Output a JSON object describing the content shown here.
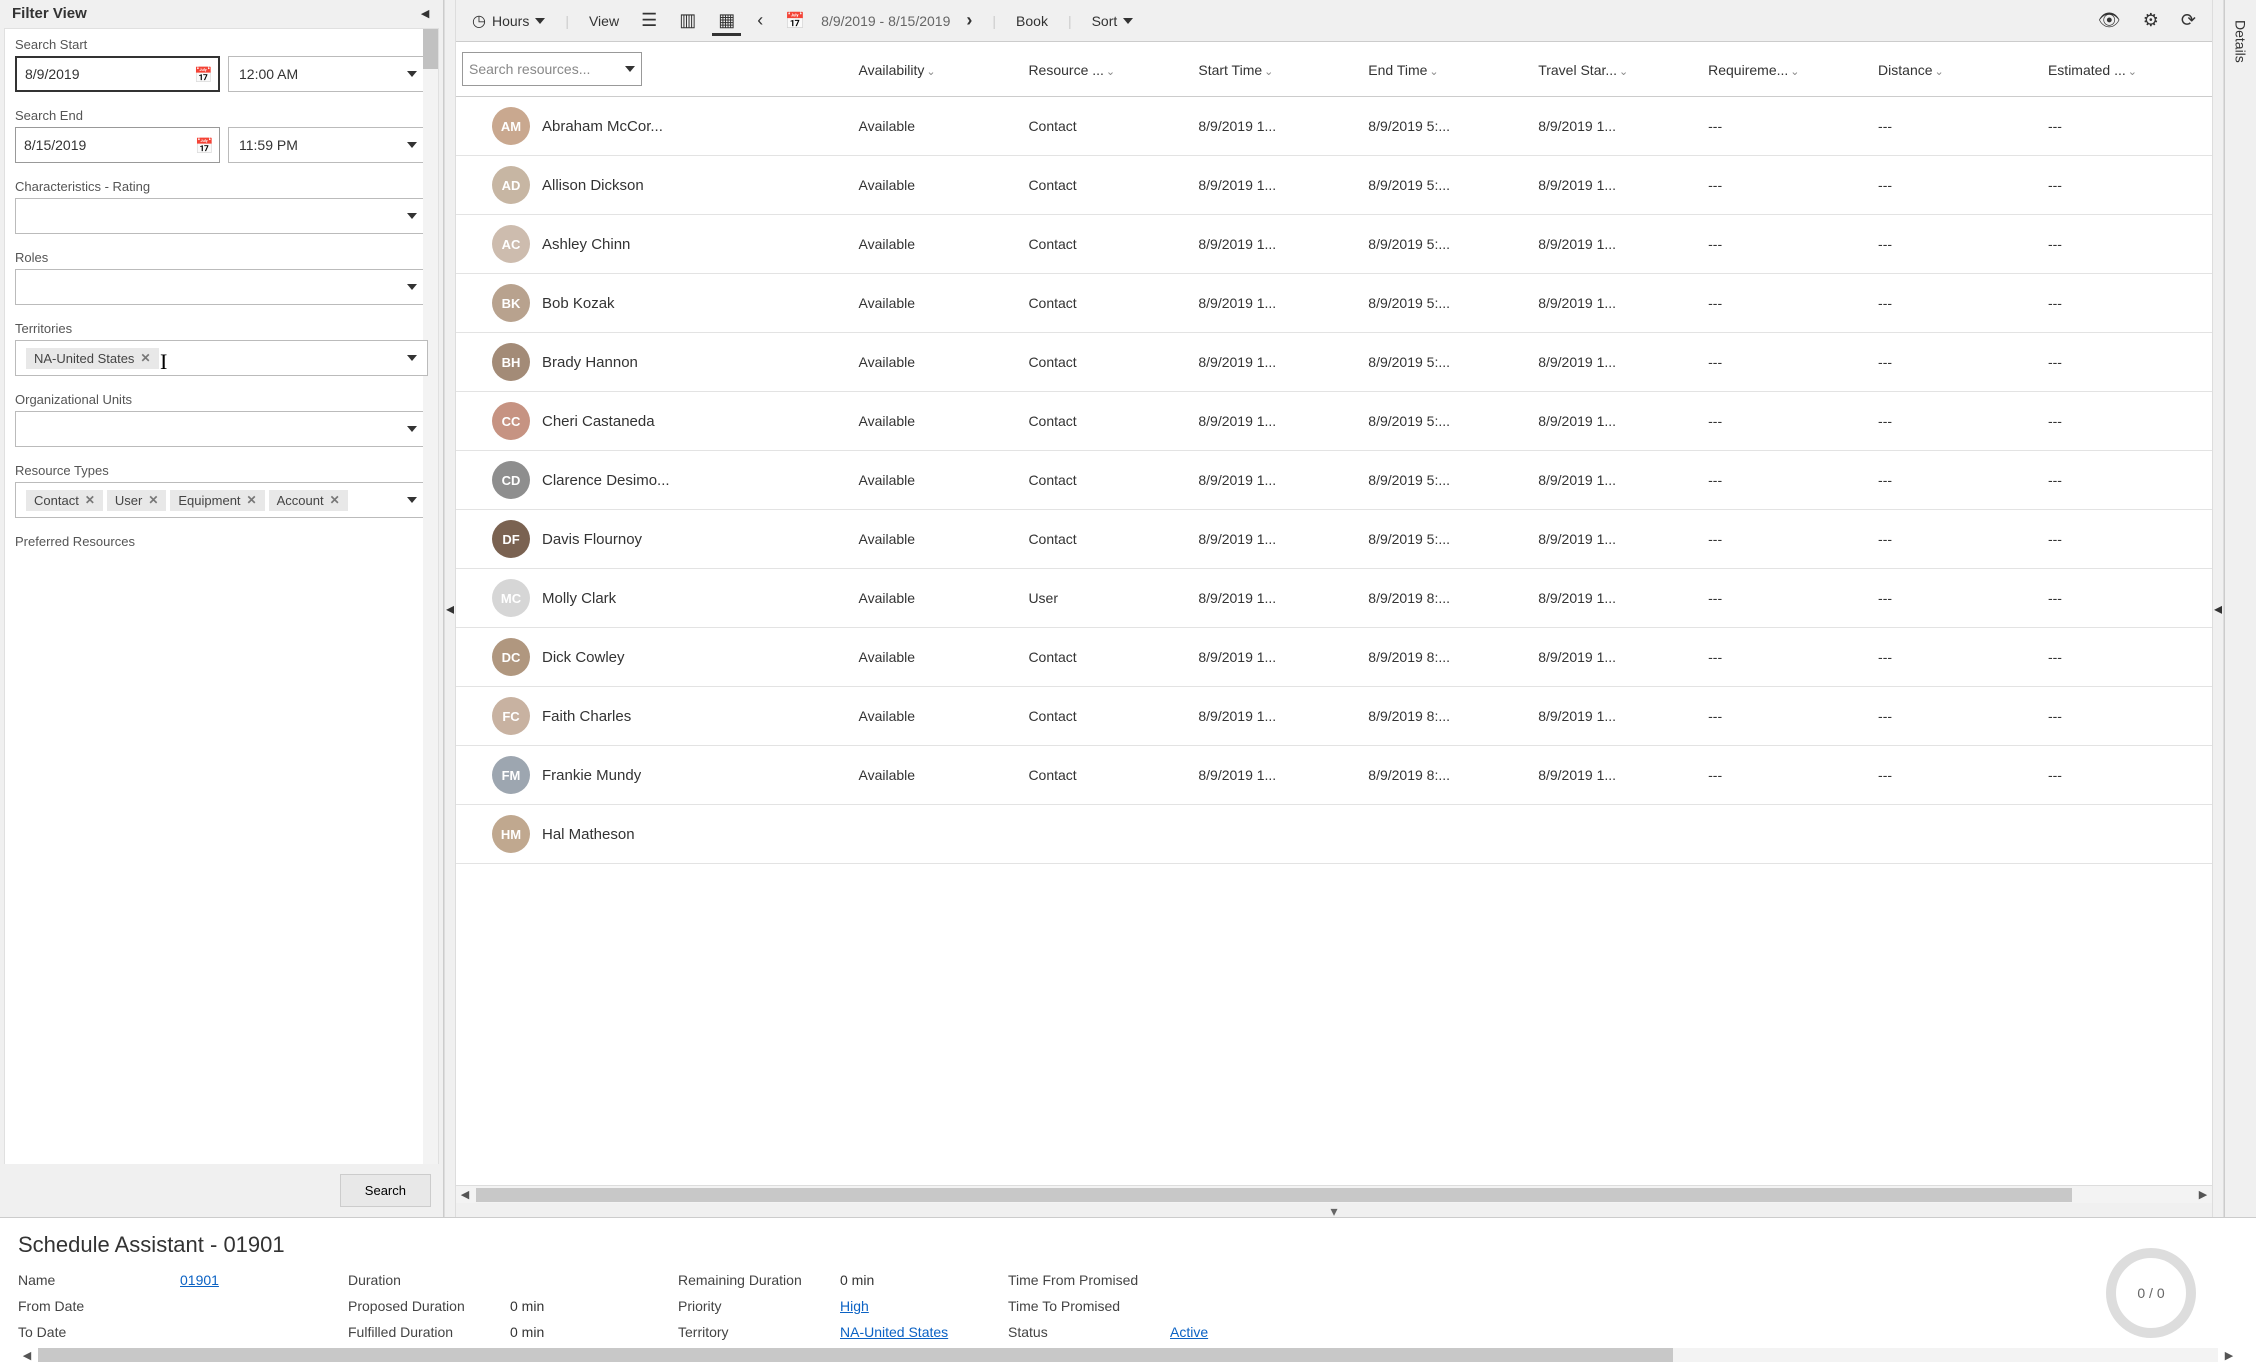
{
  "filter": {
    "title": "Filter View",
    "search_start_label": "Search Start",
    "search_start_date": "8/9/2019",
    "search_start_time": "12:00 AM",
    "search_end_label": "Search End",
    "search_end_date": "8/15/2019",
    "search_end_time": "11:59 PM",
    "characteristics_label": "Characteristics - Rating",
    "roles_label": "Roles",
    "territories_label": "Territories",
    "territories_tags": [
      "NA-United States"
    ],
    "org_units_label": "Organizational Units",
    "resource_types_label": "Resource Types",
    "resource_types_tags": [
      "Contact",
      "User",
      "Equipment",
      "Account"
    ],
    "preferred_resources_label": "Preferred Resources",
    "search_button": "Search"
  },
  "toolbar": {
    "hours_label": "Hours",
    "view_label": "View",
    "date_range": "8/9/2019 - 8/15/2019",
    "book_label": "Book",
    "sort_label": "Sort"
  },
  "table": {
    "search_placeholder": "Search resources...",
    "columns": [
      "Availability",
      "Resource ...",
      "Start Time",
      "End Time",
      "Travel Star...",
      "Requireme...",
      "Distance",
      "Estimated ..."
    ],
    "rows": [
      {
        "name": "Abraham McCor...",
        "avcolor": "#c9a88f",
        "availability": "Available",
        "type": "Contact",
        "start": "8/9/2019 1...",
        "end": "8/9/2019 5:...",
        "travel": "8/9/2019 1...",
        "req": "---",
        "dist": "---",
        "est": "---"
      },
      {
        "name": "Allison Dickson",
        "avcolor": "#c7b6a3",
        "availability": "Available",
        "type": "Contact",
        "start": "8/9/2019 1...",
        "end": "8/9/2019 5:...",
        "travel": "8/9/2019 1...",
        "req": "---",
        "dist": "---",
        "est": "---"
      },
      {
        "name": "Ashley Chinn",
        "avcolor": "#cdbcae",
        "availability": "Available",
        "type": "Contact",
        "start": "8/9/2019 1...",
        "end": "8/9/2019 5:...",
        "travel": "8/9/2019 1...",
        "req": "---",
        "dist": "---",
        "est": "---"
      },
      {
        "name": "Bob Kozak",
        "avcolor": "#b8a28e",
        "availability": "Available",
        "type": "Contact",
        "start": "8/9/2019 1...",
        "end": "8/9/2019 5:...",
        "travel": "8/9/2019 1...",
        "req": "---",
        "dist": "---",
        "est": "---"
      },
      {
        "name": "Brady Hannon",
        "avcolor": "#a38b77",
        "availability": "Available",
        "type": "Contact",
        "start": "8/9/2019 1...",
        "end": "8/9/2019 5:...",
        "travel": "8/9/2019 1...",
        "req": "---",
        "dist": "---",
        "est": "---"
      },
      {
        "name": "Cheri Castaneda",
        "avcolor": "#c69382",
        "availability": "Available",
        "type": "Contact",
        "start": "8/9/2019 1...",
        "end": "8/9/2019 5:...",
        "travel": "8/9/2019 1...",
        "req": "---",
        "dist": "---",
        "est": "---"
      },
      {
        "name": "Clarence Desimo...",
        "avcolor": "#8e8e8e",
        "availability": "Available",
        "type": "Contact",
        "start": "8/9/2019 1...",
        "end": "8/9/2019 5:...",
        "travel": "8/9/2019 1...",
        "req": "---",
        "dist": "---",
        "est": "---"
      },
      {
        "name": "Davis Flournoy",
        "avcolor": "#7a6251",
        "availability": "Available",
        "type": "Contact",
        "start": "8/9/2019 1...",
        "end": "8/9/2019 5:...",
        "travel": "8/9/2019 1...",
        "req": "---",
        "dist": "---",
        "est": "---"
      },
      {
        "name": "Molly Clark",
        "avcolor": "#d6d6d6",
        "availability": "Available",
        "type": "User",
        "start": "8/9/2019 1...",
        "end": "8/9/2019 8:...",
        "travel": "8/9/2019 1...",
        "req": "---",
        "dist": "---",
        "est": "---"
      },
      {
        "name": "Dick Cowley",
        "avcolor": "#b0977f",
        "availability": "Available",
        "type": "Contact",
        "start": "8/9/2019 1...",
        "end": "8/9/2019 8:...",
        "travel": "8/9/2019 1...",
        "req": "---",
        "dist": "---",
        "est": "---"
      },
      {
        "name": "Faith Charles",
        "avcolor": "#c8b2a1",
        "availability": "Available",
        "type": "Contact",
        "start": "8/9/2019 1...",
        "end": "8/9/2019 8:...",
        "travel": "8/9/2019 1...",
        "req": "---",
        "dist": "---",
        "est": "---"
      },
      {
        "name": "Frankie Mundy",
        "avcolor": "#9da6b0",
        "availability": "Available",
        "type": "Contact",
        "start": "8/9/2019 1...",
        "end": "8/9/2019 8:...",
        "travel": "8/9/2019 1...",
        "req": "---",
        "dist": "---",
        "est": "---"
      },
      {
        "name": "Hal Matheson",
        "avcolor": "#c0a88f",
        "availability": "",
        "type": "",
        "start": "",
        "end": "",
        "travel": "",
        "req": "",
        "dist": "",
        "est": ""
      }
    ]
  },
  "details_strip": {
    "label": "Details"
  },
  "bottom": {
    "title": "Schedule Assistant - 01901",
    "name_label": "Name",
    "name_value": "01901",
    "from_date_label": "From Date",
    "from_date_value": "",
    "to_date_label": "To Date",
    "to_date_value": "",
    "duration_label": "Duration",
    "duration_value": "",
    "proposed_duration_label": "Proposed Duration",
    "proposed_duration_value": "0 min",
    "fulfilled_duration_label": "Fulfilled Duration",
    "fulfilled_duration_value": "0 min",
    "remaining_duration_label": "Remaining Duration",
    "remaining_duration_value": "0 min",
    "priority_label": "Priority",
    "priority_value": "High",
    "territory_label": "Territory",
    "territory_value": "NA-United States",
    "time_from_promised_label": "Time From Promised",
    "time_to_promised_label": "Time To Promised",
    "status_label": "Status",
    "status_value": "Active",
    "progress_text": "0 / 0"
  }
}
